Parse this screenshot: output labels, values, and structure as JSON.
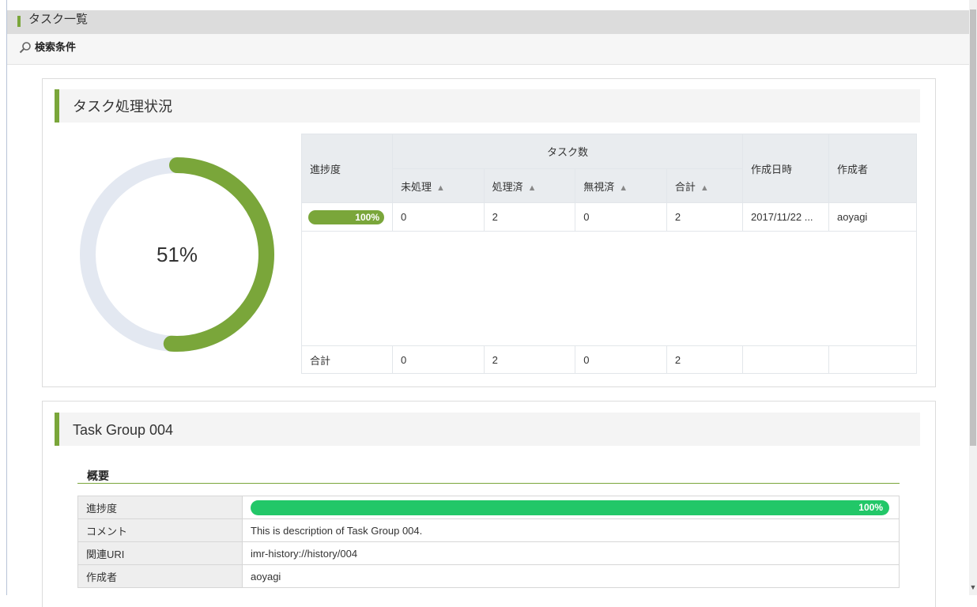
{
  "page": {
    "title": "タスク一覧",
    "search_label": "検索条件"
  },
  "status_section": {
    "title": "タスク処理状況",
    "donut_percent": "51%",
    "donut_fraction": 0.51,
    "donut_color": "#7aa63a",
    "donut_track_color": "#e3e8f1"
  },
  "task_table": {
    "headers": {
      "progress": "進捗度",
      "task_count": "タスク数",
      "unprocessed": "未処理",
      "processed": "処理済",
      "ignored": "無視済",
      "total": "合計",
      "created_at": "作成日時",
      "creator": "作成者"
    },
    "row": {
      "progress": "100%",
      "unprocessed": "0",
      "processed": "2",
      "ignored": "0",
      "total": "2",
      "created_at": "2017/11/22 ...",
      "creator": "aoyagi"
    },
    "footer": {
      "label": "合計",
      "unprocessed": "0",
      "processed": "2",
      "ignored": "0",
      "total": "2"
    }
  },
  "group_section": {
    "title": "Task Group 004",
    "summary_title": "概要",
    "rows": [
      {
        "label": "進捗度",
        "value": "100%",
        "progress_fraction": 1.0
      },
      {
        "label": "コメント",
        "value": "This is description of Task Group 004."
      },
      {
        "label": "関連URI",
        "value": "imr-history://history/004"
      },
      {
        "label": "作成者",
        "value": "aoyagi"
      }
    ]
  },
  "colors": {
    "accent_green": "#7aa63a",
    "progress_green": "#22c768"
  },
  "icons": {
    "search": "search-icon",
    "sort": "sort-icon",
    "scroll_down": "scroll-down-arrow-icon"
  }
}
